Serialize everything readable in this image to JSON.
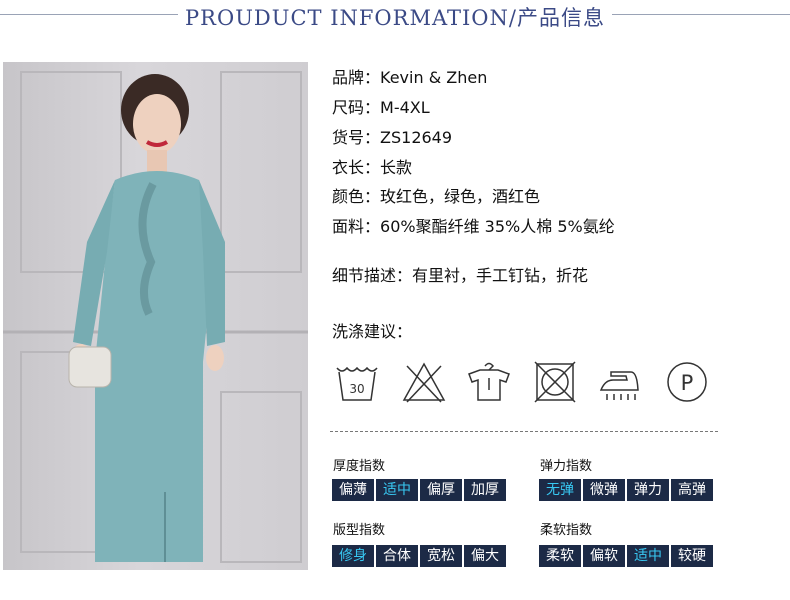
{
  "header": {
    "title": "PROUDUCT INFORMATION/产品信息"
  },
  "specs": [
    {
      "label": "品牌：",
      "value": "Kevin & Zhen"
    },
    {
      "label": "尺码：",
      "value": "M-4XL"
    },
    {
      "label": "货号：",
      "value": "ZS12649"
    },
    {
      "label": "衣长：",
      "value": "长款"
    },
    {
      "label": "颜色：",
      "value": "玫红色，绿色，酒红色"
    },
    {
      "label": "面料：",
      "value": "60%聚酯纤维 35%人棉 5%氨纶"
    }
  ],
  "details": {
    "label": "细节描述：",
    "value": "有里衬，手工钉钻，折花"
  },
  "washing": {
    "label": "洗涤建议：",
    "icons": [
      {
        "name": "wash-30-icon",
        "text": "30"
      },
      {
        "name": "do-not-bleach-icon"
      },
      {
        "name": "hang-dry-icon"
      },
      {
        "name": "do-not-tumble-dry-icon"
      },
      {
        "name": "iron-icon"
      },
      {
        "name": "dry-clean-p-icon",
        "text": "P"
      }
    ]
  },
  "indices": [
    {
      "title": "厚度指数",
      "options": [
        "偏薄",
        "适中",
        "偏厚",
        "加厚"
      ],
      "active": 1
    },
    {
      "title": "弹力指数",
      "options": [
        "无弹",
        "微弹",
        "弹力",
        "高弹"
      ],
      "active": 0
    },
    {
      "title": "版型指数",
      "options": [
        "修身",
        "合体",
        "宽松",
        "偏大"
      ],
      "active": 0
    },
    {
      "title": "柔软指数",
      "options": [
        "柔软",
        "偏软",
        "适中",
        "较硬"
      ],
      "active": 2
    }
  ],
  "colors": {
    "accent": "#38c8f2",
    "cell_bg": "#1c2a46",
    "header": "#3b4a86",
    "dress": "#7fb3b9"
  }
}
